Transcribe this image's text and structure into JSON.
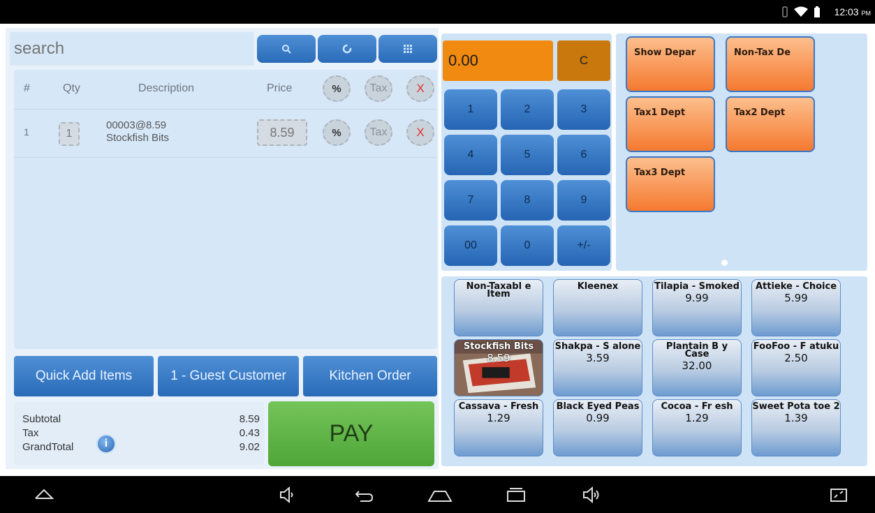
{
  "status_bar": {
    "time": "12:03",
    "ampm": "PM",
    "icons": [
      "vibrate-icon",
      "wifi-icon",
      "battery-icon"
    ]
  },
  "search": {
    "placeholder": "search",
    "value": ""
  },
  "toolbar": {
    "icons": [
      "search-icon",
      "refresh-icon",
      "barcode-icon"
    ]
  },
  "cart": {
    "headers": {
      "num": "#",
      "qty": "Qty",
      "description": "Description",
      "price": "Price",
      "discount": "%",
      "tax": "Tax",
      "delete": "X"
    },
    "rows": [
      {
        "num": "1",
        "qty": "1",
        "code": "00003@8.59",
        "name": "Stockfish Bits",
        "price": "8.59",
        "discount": "%",
        "tax": "Tax",
        "delete": "X"
      }
    ]
  },
  "tabs": {
    "quick_add": "Quick Add Items",
    "customer": "1 - Guest Customer",
    "kitchen": "Kitchen Order"
  },
  "totals": {
    "subtotal_label": "Subtotal",
    "subtotal": "8.59",
    "tax_label": "Tax",
    "tax": "0.43",
    "grand_label": "GrandTotal",
    "grand": "9.02",
    "info": "i"
  },
  "pay_label": "PAY",
  "keypad": {
    "display": "0.00",
    "clear": "C",
    "keys": [
      "1",
      "2",
      "3",
      "4",
      "5",
      "6",
      "7",
      "8",
      "9",
      "00",
      "0",
      "+/-"
    ]
  },
  "departments": [
    "Show Depar",
    "Non-Tax De",
    "Tax1 Dept",
    "Tax2 Dept",
    "Tax3 Dept"
  ],
  "items": [
    {
      "name": "Non-Taxabl e Item",
      "price": ""
    },
    {
      "name": "Kleenex",
      "price": ""
    },
    {
      "name": "Tilapia - Smoked",
      "price": "9.99"
    },
    {
      "name": "Attieke - Choice",
      "price": "5.99"
    },
    {
      "name": "Stockfish Bits",
      "price": "8.59"
    },
    {
      "name": "Shakpa - S alone",
      "price": "3.59"
    },
    {
      "name": "Plantain B y Case",
      "price": "32.00"
    },
    {
      "name": "FooFoo - F atuku",
      "price": "2.50"
    },
    {
      "name": "Cassava - Fresh",
      "price": "1.29"
    },
    {
      "name": "Black Eyed Peas",
      "price": "0.99"
    },
    {
      "name": "Cocoa - Fr esh",
      "price": "1.29"
    },
    {
      "name": "Sweet Pota toe 2",
      "price": "1.39"
    }
  ],
  "nav_bar": {
    "icons": [
      "home-up-icon",
      "volume-down-icon",
      "back-icon",
      "home-icon",
      "recents-icon",
      "volume-up-icon",
      "screenshot-icon"
    ]
  }
}
